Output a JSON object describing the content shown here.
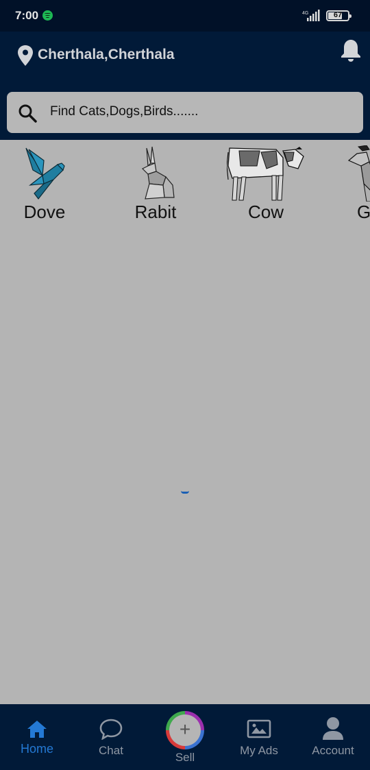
{
  "status_bar": {
    "time": "7:00",
    "network": "4G",
    "battery": "67"
  },
  "header": {
    "location": "Cherthala,Cherthala"
  },
  "search": {
    "placeholder": "Find Cats,Dogs,Birds......."
  },
  "categories": [
    {
      "label": "Dove",
      "icon": "dove-icon"
    },
    {
      "label": "Rabit",
      "icon": "rabbit-icon"
    },
    {
      "label": "Cow",
      "icon": "cow-icon"
    },
    {
      "label": "G",
      "icon": "goat-icon"
    }
  ],
  "bottom_nav": {
    "items": [
      {
        "label": "Home",
        "icon": "home-icon",
        "active": true
      },
      {
        "label": "Chat",
        "icon": "chat-icon",
        "active": false
      },
      {
        "label": "Sell",
        "icon": "plus-icon",
        "active": false
      },
      {
        "label": "My Ads",
        "icon": "image-icon",
        "active": false
      },
      {
        "label": "Account",
        "icon": "person-icon",
        "active": false
      }
    ]
  },
  "colors": {
    "header_bg": "#011a38",
    "page_bg": "#b4b4b4",
    "active_nav": "#2479d4"
  }
}
